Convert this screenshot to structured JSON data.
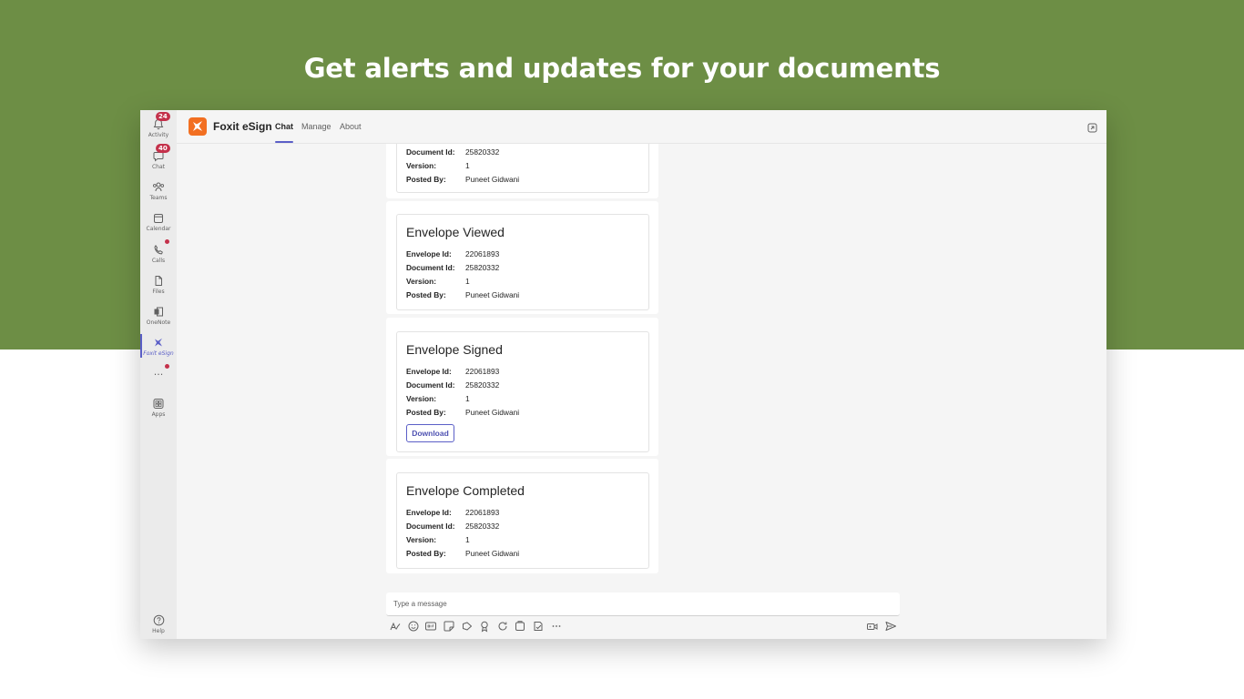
{
  "headline": "Get alerts and updates for your documents",
  "rail": {
    "items": [
      {
        "label": "Activity",
        "badge": "24"
      },
      {
        "label": "Chat",
        "badge": "40"
      },
      {
        "label": "Teams"
      },
      {
        "label": "Calendar"
      },
      {
        "label": "Calls"
      },
      {
        "label": "Files"
      },
      {
        "label": "OneNote"
      },
      {
        "label": "Foxit eSign"
      },
      {
        "label": "Apps"
      },
      {
        "label": "Help"
      }
    ],
    "more_label": "···"
  },
  "app": {
    "name": "Foxit eSign",
    "tabs": [
      "Chat",
      "Manage",
      "About"
    ],
    "active_tab": "Chat",
    "brand_color": "#f26f21",
    "accent_color": "#5b5fc7"
  },
  "messages": [
    {
      "rows": [
        {
          "key": "Document Id:",
          "value": "25820332"
        },
        {
          "key": "Version:",
          "value": "1"
        },
        {
          "key": "Posted By:",
          "value": "Puneet Gidwani"
        }
      ]
    },
    {
      "title": "Envelope Viewed",
      "rows": [
        {
          "key": "Envelope Id:",
          "value": "22061893"
        },
        {
          "key": "Document Id:",
          "value": "25820332"
        },
        {
          "key": "Version:",
          "value": "1"
        },
        {
          "key": "Posted By:",
          "value": "Puneet Gidwani"
        }
      ]
    },
    {
      "title": "Envelope Signed",
      "rows": [
        {
          "key": "Envelope Id:",
          "value": "22061893"
        },
        {
          "key": "Document Id:",
          "value": "25820332"
        },
        {
          "key": "Version:",
          "value": "1"
        },
        {
          "key": "Posted By:",
          "value": "Puneet Gidwani"
        }
      ],
      "button": "Download"
    },
    {
      "title": "Envelope Completed",
      "rows": [
        {
          "key": "Envelope Id:",
          "value": "22061893"
        },
        {
          "key": "Document Id:",
          "value": "25820332"
        },
        {
          "key": "Version:",
          "value": "1"
        },
        {
          "key": "Posted By:",
          "value": "Puneet Gidwani"
        }
      ]
    }
  ],
  "composer": {
    "placeholder": "Type a message",
    "tools": [
      "format-icon",
      "emoji-icon",
      "gif-icon",
      "sticker-icon",
      "meet-now-icon",
      "praise-icon",
      "loop-icon",
      "share-icon",
      "approvals-icon",
      "more-icon"
    ],
    "right_tools": [
      "record-video-icon",
      "send-icon"
    ]
  }
}
